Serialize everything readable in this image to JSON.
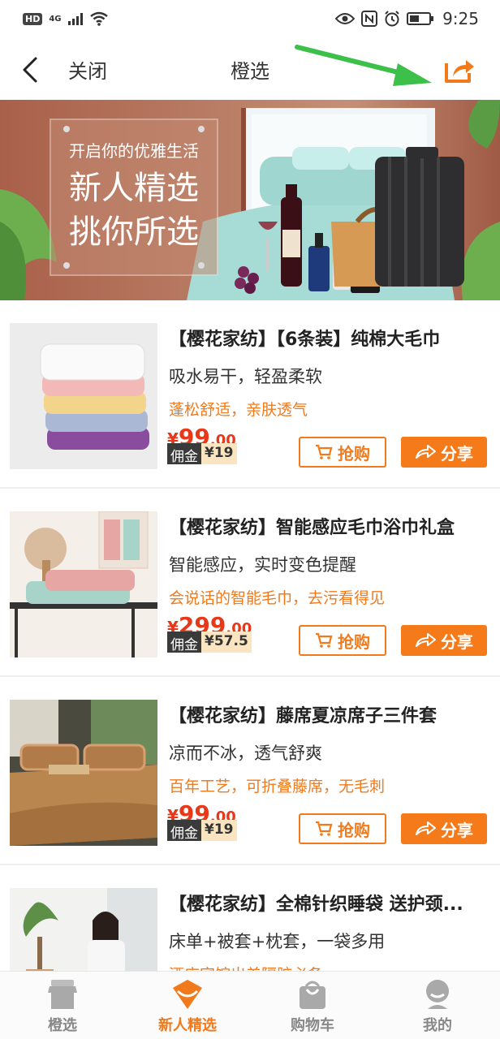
{
  "status_bar": {
    "hd": "HD",
    "network": "4G",
    "time": "9:25"
  },
  "nav": {
    "close_label": "关闭",
    "title": "橙选"
  },
  "banner": {
    "line1": "开启你的优雅生活",
    "line2": "新人精选",
    "line3": "挑你所选"
  },
  "currency": "¥",
  "products": [
    {
      "title": "【樱花家纺】【6条装】纯棉大毛巾",
      "subtitle": "吸水易干，轻盈柔软",
      "highlight": "蓬松舒适，亲肤透气",
      "price_int": "99",
      "price_dec": ".00",
      "commission_label": "佣金",
      "commission": "¥19",
      "buy_label": "抢购",
      "share_label": "分享"
    },
    {
      "title": "【樱花家纺】智能感应毛巾浴巾礼盒",
      "subtitle": "智能感应，实时变色提醒",
      "highlight": "会说话的智能毛巾，去污看得见",
      "price_int": "299",
      "price_dec": ".00",
      "commission_label": "佣金",
      "commission": "¥57.5",
      "buy_label": "抢购",
      "share_label": "分享"
    },
    {
      "title": "【樱花家纺】藤席夏凉席子三件套",
      "subtitle": "凉而不冰，透气舒爽",
      "highlight": "百年工艺，可折叠藤席，无毛刺",
      "price_int": "99",
      "price_dec": ".00",
      "commission_label": "佣金",
      "commission": "¥19",
      "buy_label": "抢购",
      "share_label": "分享"
    },
    {
      "title": "【樱花家纺】全棉针织睡袋 送护颈...",
      "subtitle": "床单+被套+枕套，一袋多用",
      "highlight": "酒店宾馆出差隔脏必备"
    }
  ],
  "tabs": [
    {
      "label": "橙选",
      "icon": "store-icon",
      "active": false
    },
    {
      "label": "新人精选",
      "icon": "gift-icon",
      "active": true
    },
    {
      "label": "购物车",
      "icon": "bag-icon",
      "active": false
    },
    {
      "label": "我的",
      "icon": "user-icon",
      "active": false
    }
  ],
  "colors": {
    "accent": "#f07a1c",
    "price": "#e8381a",
    "arrow": "#3cc04a"
  }
}
